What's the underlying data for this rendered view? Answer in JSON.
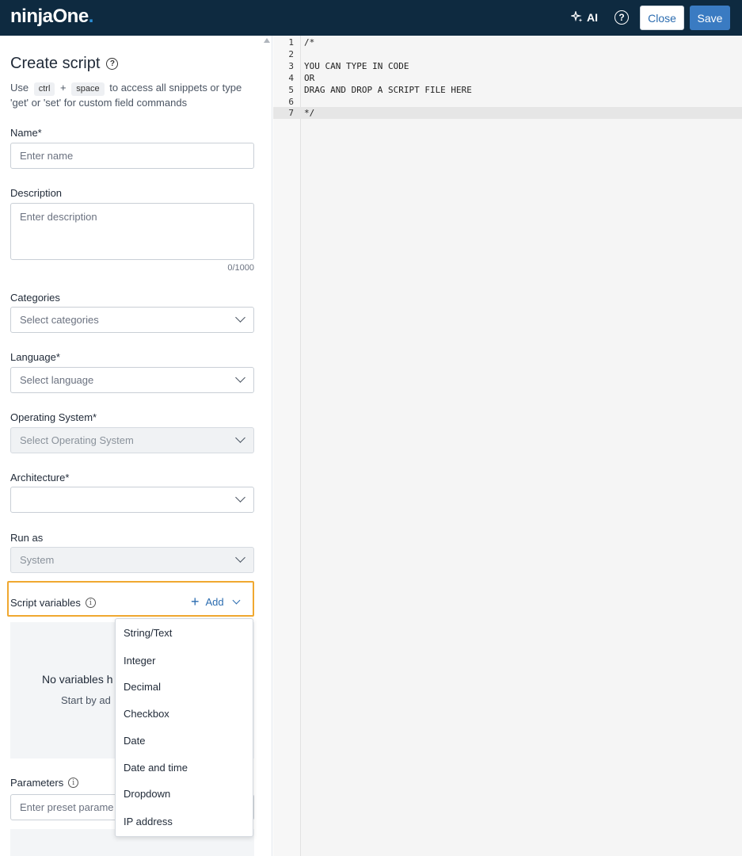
{
  "header": {
    "logo_main": "ninjaOne",
    "logo_dot": ".",
    "ai_label": "AI",
    "close_label": "Close",
    "save_label": "Save",
    "icons": [
      "sparkle-icon",
      "help-icon"
    ]
  },
  "form": {
    "title": "Create script",
    "hint_use": "Use",
    "hint_key1": "ctrl",
    "hint_plus": "+",
    "hint_key2": "space",
    "hint_rest": "to access all snippets or type 'get' or 'set' for custom field commands",
    "name_label": "Name*",
    "name_placeholder": "Enter name",
    "description_label": "Description",
    "description_placeholder": "Enter description",
    "description_counter": "0/1000",
    "categories_label": "Categories",
    "categories_placeholder": "Select categories",
    "language_label": "Language*",
    "language_placeholder": "Select language",
    "os_label": "Operating System*",
    "os_placeholder": "Select Operating System",
    "architecture_label": "Architecture*",
    "architecture_value": "",
    "runas_label": "Run as",
    "runas_value": "System",
    "script_variables_label": "Script variables",
    "add_label": "Add",
    "empty_title": "No variables h",
    "empty_sub": "Start by ad",
    "parameters_label": "Parameters",
    "parameters_placeholder": "Enter preset parame"
  },
  "dropdown": {
    "items": [
      "String/Text",
      "Integer",
      "Decimal",
      "Checkbox",
      "Date",
      "Date and time",
      "Dropdown",
      "IP address"
    ]
  },
  "editor": {
    "lines": [
      {
        "num": "1",
        "text": "/*"
      },
      {
        "num": "2",
        "text": ""
      },
      {
        "num": "3",
        "text": "YOU CAN TYPE IN CODE"
      },
      {
        "num": "4",
        "text": "OR"
      },
      {
        "num": "5",
        "text": "DRAG AND DROP A SCRIPT FILE HERE"
      },
      {
        "num": "6",
        "text": ""
      },
      {
        "num": "7",
        "text": "*/"
      }
    ]
  },
  "colors": {
    "header_bg": "#0e2a40",
    "accent": "#3a7bc2",
    "highlight": "#f0a830"
  }
}
